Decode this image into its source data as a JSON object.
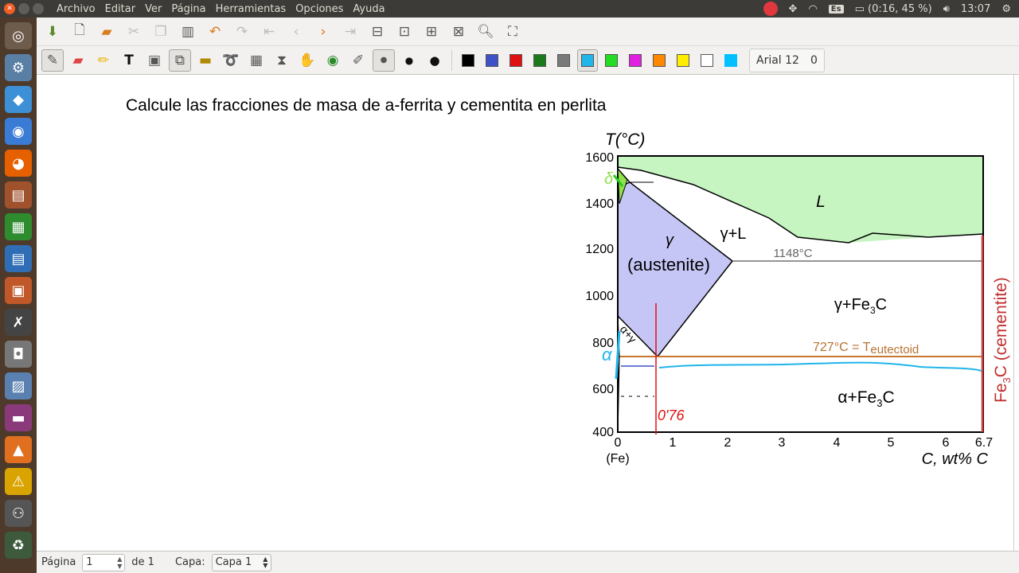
{
  "menubar": {
    "items": [
      "Archivo",
      "Editar",
      "Ver",
      "Página",
      "Herramientas",
      "Opciones",
      "Ayuda"
    ],
    "keyboard": "Es",
    "battery": "(0:16, 45 %)",
    "clock": "13:07"
  },
  "launcher": [
    "ubuntu-dash-icon",
    "system-icon",
    "dropbox-icon",
    "chrome-icon",
    "firefox-icon",
    "files-icon",
    "calc-icon",
    "writer-icon",
    "impress-icon",
    "xournal-icon",
    "camera-icon",
    "screenshot-icon",
    "media-icon",
    "vlc-icon",
    "warning-icon",
    "network-icon",
    "trash-icon"
  ],
  "toolbar": {
    "font_label": "Arial 12",
    "font_value": "0",
    "colors": [
      "#000000",
      "#3f51c8",
      "#e01010",
      "#1a7a1a",
      "#7a7a7a",
      "#21b5ea",
      "#22dd22",
      "#e020e0",
      "#ff8800",
      "#ffee00",
      "#ffffff"
    ],
    "highlight_color": "#00c0ff"
  },
  "canvas": {
    "prompt": "Calcule las fracciones de masa de a-ferrita y cementita en perlita"
  },
  "diagram": {
    "t_label": "T(°C)",
    "y_ticks": [
      "1600",
      "1400",
      "1200",
      "1000",
      "800",
      "600",
      "400"
    ],
    "x_ticks": [
      "0",
      "1",
      "2",
      "3",
      "4",
      "5",
      "6",
      "6.7"
    ],
    "x_fe": "(Fe)",
    "x_label": "C, wt% C",
    "L": "L",
    "gamma_L": "γ+L",
    "gamma": "γ",
    "austenite": "(austenite)",
    "t1148": "1148°C",
    "gamma_fe3c": "γ+Fe",
    "eutectoid_prefix": "727°C = T",
    "eutectoid_sub": "eutectoid",
    "alpha_fe3c": "α+Fe",
    "cementite_label": "Fe",
    "cementite_suffix": "C (cementite)",
    "sub3": "3",
    "c_suffix": "C",
    "delta": "δ",
    "alpha": "α",
    "alpha_gamma": "α+γ",
    "handwritten": "0'76"
  },
  "statusbar": {
    "page_label": "Página",
    "page_value": "1",
    "of_label": "de 1",
    "layer_label": "Capa:",
    "layer_value": "Capa 1"
  }
}
